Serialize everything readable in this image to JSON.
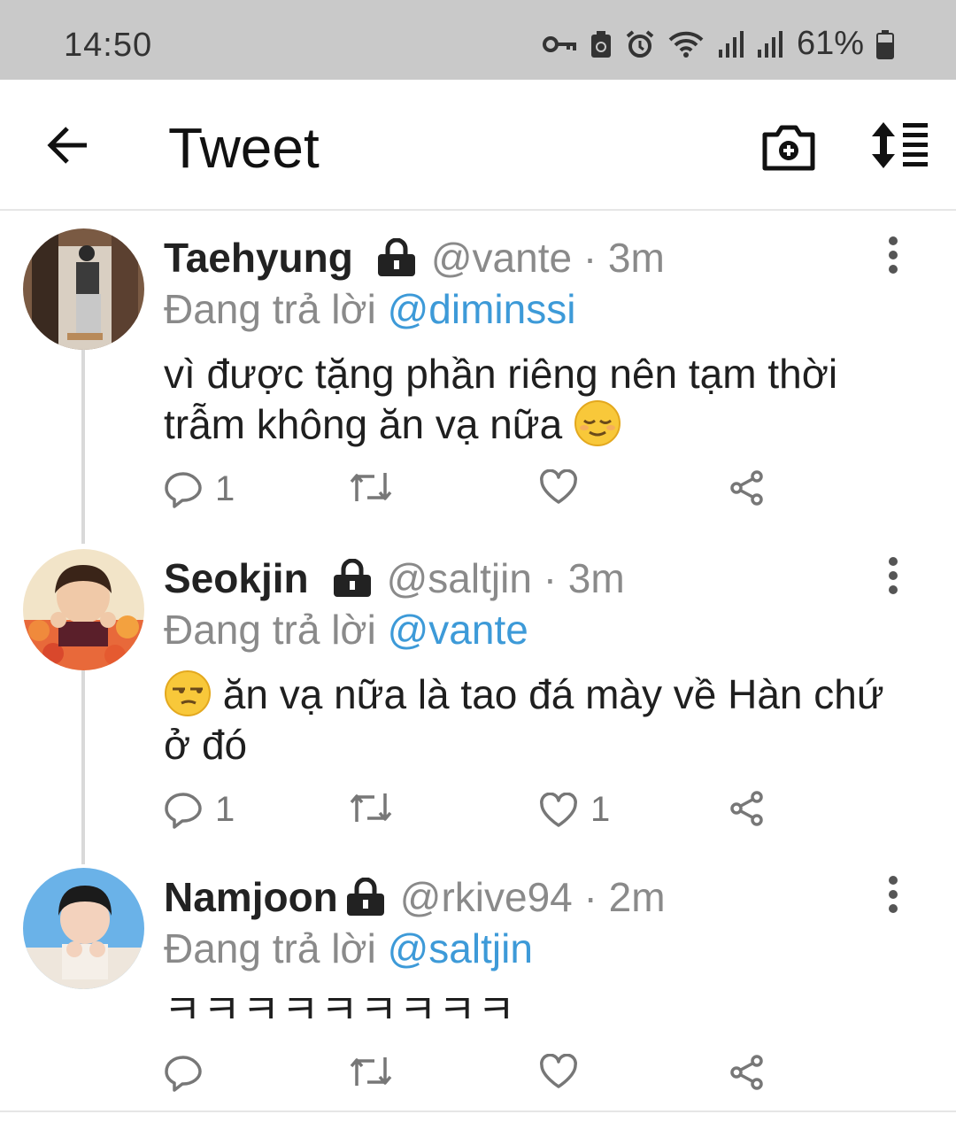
{
  "status_bar": {
    "time": "14:50",
    "battery": "61%",
    "icons": [
      "vpn-key-icon",
      "recycle-icon",
      "alarm-icon",
      "wifi-icon",
      "signal-icon",
      "signal-icon",
      "battery-icon"
    ]
  },
  "app_bar": {
    "title": "Tweet",
    "back_icon": "arrow-left-icon",
    "camera_icon": "camera-plus-icon",
    "sort_icon": "sort-icon"
  },
  "tweets": [
    {
      "name": "Taehyung",
      "handle": "@vante · 3m",
      "reply_prefix": "Đang trả lời",
      "reply_to": "@diminssi",
      "text_line1": "vì được tặng phần riêng nên tạm thời",
      "text_line2": "trẫm không ăn vạ nữa",
      "emoji": "relieved-face",
      "reply_count": "1",
      "retweet_count": "",
      "like_count": ""
    },
    {
      "name": "Seokjin",
      "handle": "@saltjin · 3m",
      "reply_prefix": "Đang trả lời",
      "reply_to": "@vante",
      "text_line1": "ăn vạ nữa là tao đá mày về Hàn chứ",
      "text_line2": "ở đó",
      "emoji": "unamused-face",
      "reply_count": "1",
      "retweet_count": "",
      "like_count": "1"
    },
    {
      "name": "Namjoon",
      "handle": "@rkive94 · 2m",
      "reply_prefix": "Đang trả lời",
      "reply_to": "@saltjin",
      "text_line1": "ㅋㅋㅋㅋㅋㅋㅋㅋㅋ",
      "reply_count": "",
      "retweet_count": "",
      "like_count": ""
    }
  ],
  "colors": {
    "mention": "#3d9ad8",
    "muted": "#8a8a8a",
    "status_bar": "#c9c9c9"
  }
}
